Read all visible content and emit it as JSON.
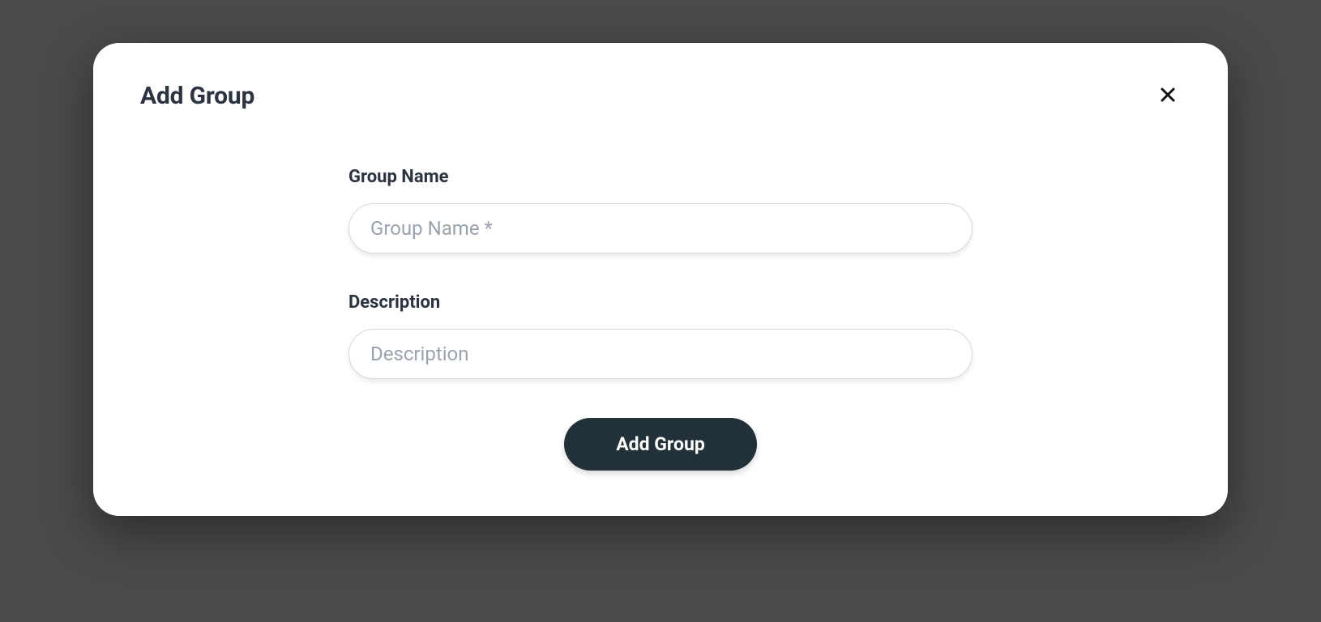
{
  "modal": {
    "title": "Add Group",
    "fields": {
      "group_name": {
        "label": "Group Name",
        "placeholder": "Group Name *",
        "value": ""
      },
      "description": {
        "label": "Description",
        "placeholder": "Description",
        "value": ""
      }
    },
    "submit_label": "Add Group"
  }
}
